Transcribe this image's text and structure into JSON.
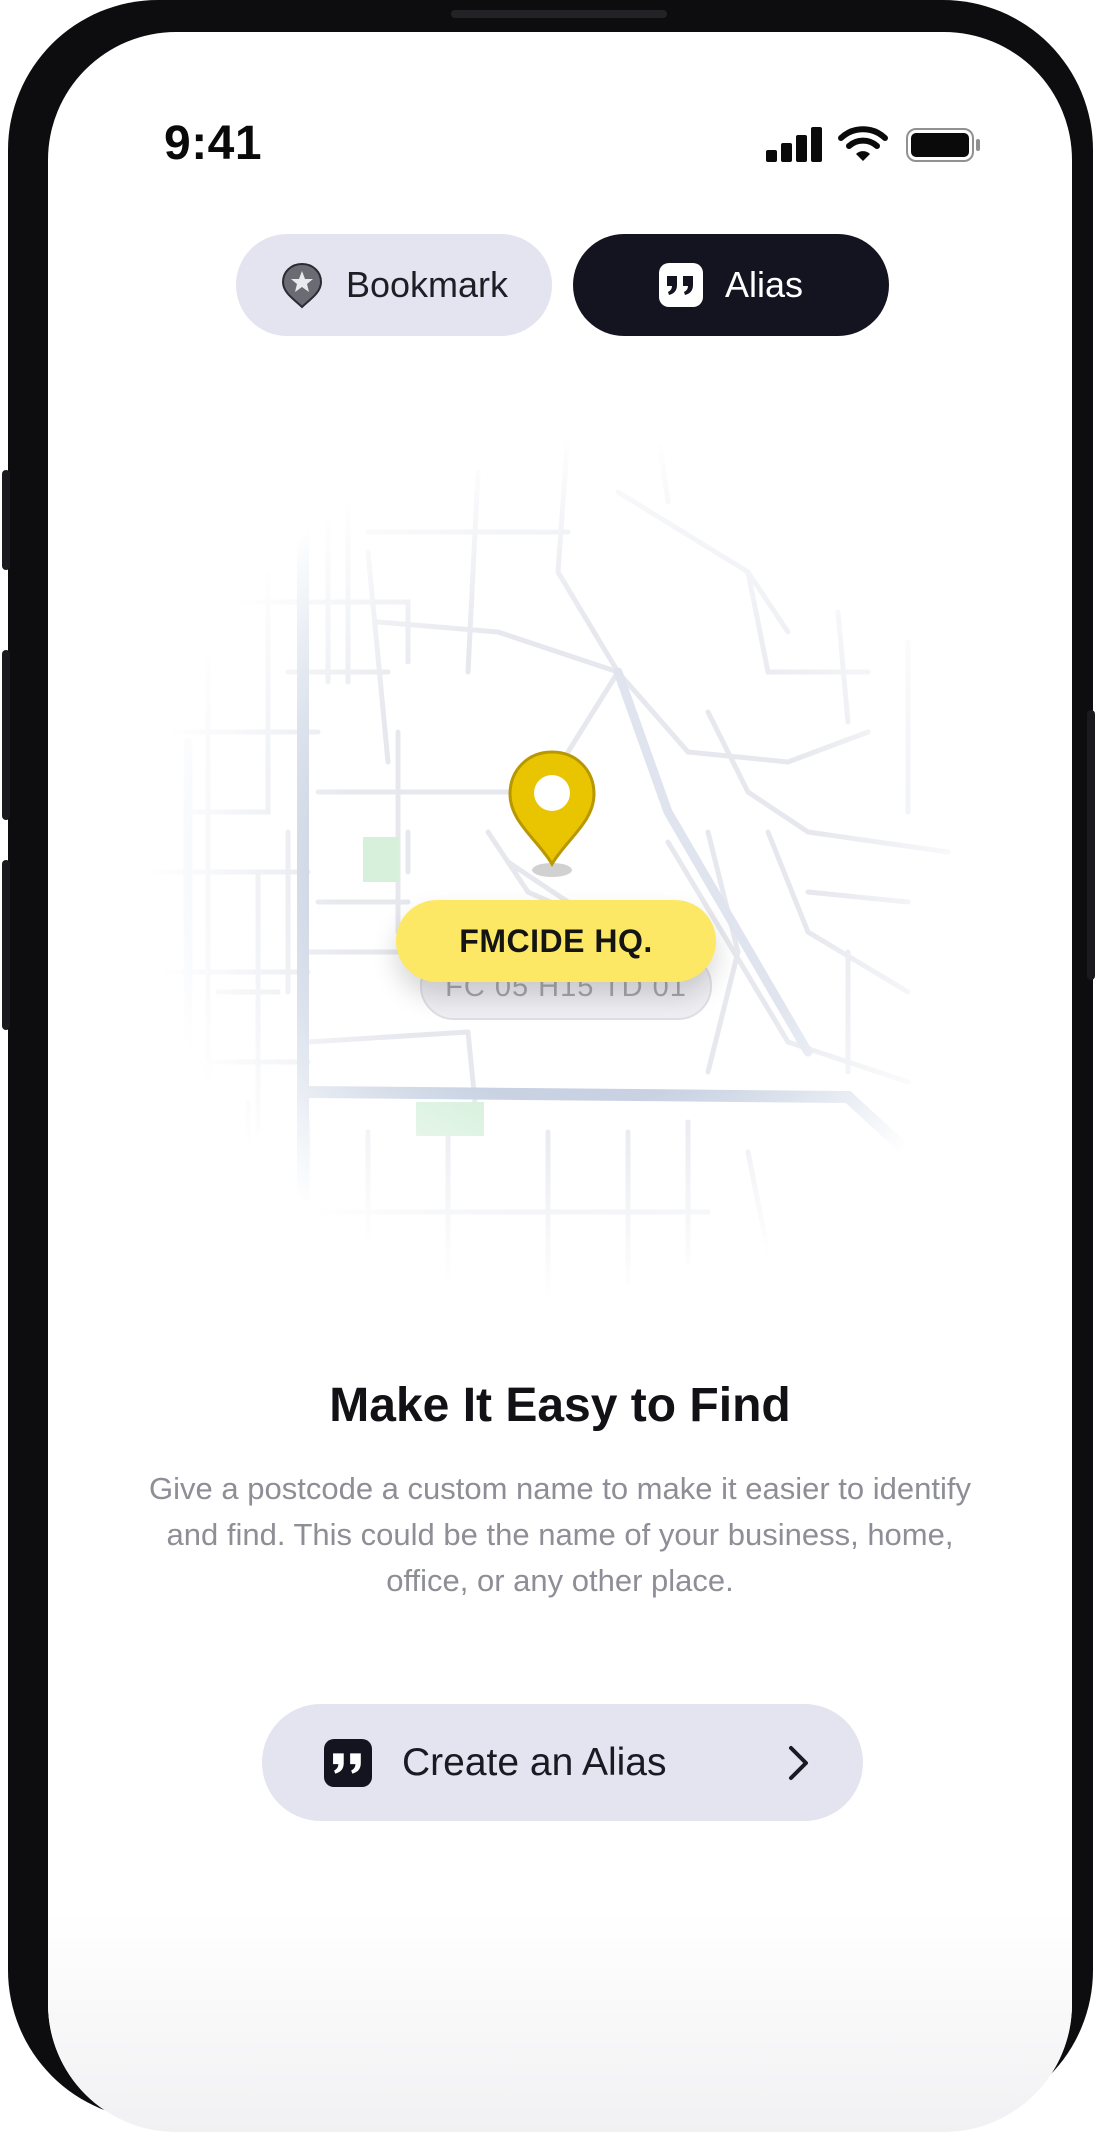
{
  "status_bar": {
    "time": "9:41"
  },
  "tabs": [
    {
      "label": "Bookmark",
      "icon": "bookmark-pin-icon",
      "active": false
    },
    {
      "label": "Alias",
      "icon": "quote-icon",
      "active": true
    }
  ],
  "map": {
    "alias_name": "FMCIDE HQ.",
    "postcode": "FC 05 H15 TD 01",
    "pin_color": "#e9c400",
    "park_color": "#d6f0dc"
  },
  "content": {
    "headline": "Make It Easy to Find",
    "description": "Give a postcode a custom name to make it easier to identify and find. This could be the name of your business, home, office, or any other place."
  },
  "cta": {
    "label": "Create an Alias",
    "icon": "quote-icon",
    "trailing_icon": "chevron-right-icon"
  },
  "colors": {
    "dark": "#141420",
    "pill_bg": "#e4e3f0",
    "accent_yellow": "#fde865"
  }
}
